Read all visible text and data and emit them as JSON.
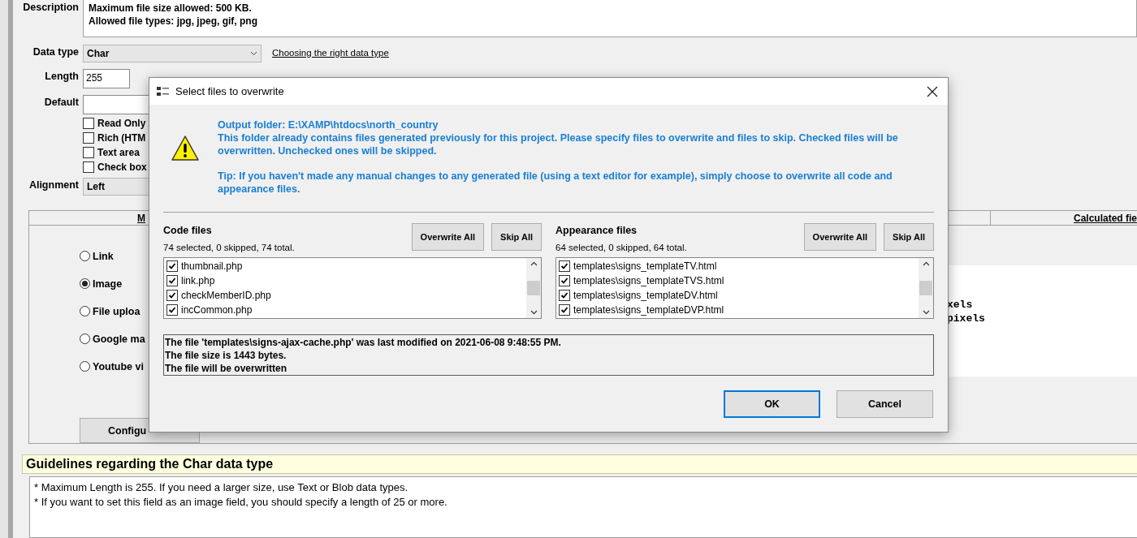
{
  "form": {
    "description_label": "Description",
    "description_lines": [
      "Maximum file size allowed: 500 KB.",
      "Allowed file types: jpg, jpeg, gif, png"
    ],
    "data_type": {
      "label": "Data type",
      "value": "Char"
    },
    "data_type_link": "Choosing the right data type",
    "length": {
      "label": "Length",
      "value": "255"
    },
    "default": {
      "label": "Default"
    },
    "options": [
      {
        "label": "Read Only",
        "checked": false
      },
      {
        "label": "Rich (HTM",
        "checked": false
      },
      {
        "label": "Text area",
        "checked": false
      },
      {
        "label": "Check box",
        "checked": false
      }
    ],
    "alignment": {
      "label": "Alignment",
      "value": "Left"
    }
  },
  "tabs": [
    {
      "label": "M"
    },
    {
      "label": "Calculated fie"
    }
  ],
  "field_types": [
    {
      "label": "Link",
      "selected": false
    },
    {
      "label": "Image",
      "selected": true
    },
    {
      "label": "File uploa",
      "selected": false
    },
    {
      "label": "Google ma",
      "selected": false
    },
    {
      "label": "Youtube vi",
      "selected": false
    }
  ],
  "configure_button": "Configu",
  "preview_lines": [
    "xels",
    "pixels"
  ],
  "guidelines": {
    "title": "Guidelines regarding the Char data type",
    "lines": [
      "* Maximum Length is 255. If you need a larger size, use Text or Blob data types.",
      "* If you want to set this field as an image field, you should specify a length of 25 or more."
    ]
  },
  "dialog": {
    "title": "Select files to overwrite",
    "folder_line": "Output folder: E:\\XAMP\\htdocs\\north_country",
    "message": "This folder already contains files generated previously for this project. Please specify files to overwrite and files to skip. Checked files will be overwritten. Unchecked ones will be skipped.",
    "tip": "Tip: If you haven't made any manual changes to any generated file (using a text editor for example), simply choose to overwrite all code and appearance files.",
    "sections": [
      {
        "title": "Code files",
        "summary": "74 selected, 0 skipped, 74 total.",
        "buttons": [
          "Overwrite All",
          "Skip All"
        ],
        "files": [
          {
            "name": "thumbnail.php",
            "checked": true
          },
          {
            "name": "link.php",
            "checked": true
          },
          {
            "name": "checkMemberID.php",
            "checked": true
          },
          {
            "name": "incCommon.php",
            "checked": true
          }
        ]
      },
      {
        "title": "Appearance files",
        "summary": "64 selected, 0 skipped, 64 total.",
        "buttons": [
          "Overwrite All",
          "Skip All"
        ],
        "files": [
          {
            "name": "templates\\signs_templateTV.html",
            "checked": true
          },
          {
            "name": "templates\\signs_templateTVS.html",
            "checked": true
          },
          {
            "name": "templates\\signs_templateDV.html",
            "checked": true
          },
          {
            "name": "templates\\signs_templateDVP.html",
            "checked": true
          }
        ]
      }
    ],
    "info_lines": [
      "The file 'templates\\signs-ajax-cache.php' was last modified on 2021-06-08 9:48:55 PM.",
      "The file size is 1443 bytes.",
      "The file will be overwritten"
    ],
    "buttons": [
      {
        "label": "OK",
        "focused": true
      },
      {
        "label": "Cancel",
        "focused": false
      }
    ]
  }
}
